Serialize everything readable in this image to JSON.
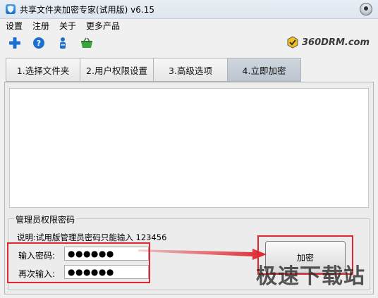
{
  "window": {
    "title": "共享文件夹加密专家(试用版) v6.15"
  },
  "menu": [
    "设置",
    "注册",
    "关于",
    "更多产品"
  ],
  "toolbar": [
    {
      "icon": "plus-icon",
      "color": "#1a6fd1"
    },
    {
      "icon": "help-icon",
      "color": "#1a6fd1"
    },
    {
      "icon": "user-info-icon",
      "color": "#1a6fd1"
    },
    {
      "icon": "basket-icon",
      "color": "#3da33d"
    }
  ],
  "brand": {
    "text": "360DRM.com"
  },
  "tabs": [
    {
      "label": "1.选择文件夹",
      "active": false
    },
    {
      "label": "2.用户权限设置",
      "active": false
    },
    {
      "label": "3.高级选项",
      "active": false
    },
    {
      "label": "4.立即加密",
      "active": true
    }
  ],
  "admin": {
    "group_title": "管理员权限密码",
    "note": "说明:试用版管理员密码只能输入 123456",
    "password_label": "输入密码:",
    "password_value": "●●●●●●",
    "confirm_label": "再次输入:",
    "confirm_value": "●●●●●●"
  },
  "encrypt_button": {
    "label": "加密"
  },
  "watermark": {
    "text": "极速下载站"
  },
  "colors": {
    "highlight": "#e0262f",
    "active_tab": "#c5cdd6"
  }
}
